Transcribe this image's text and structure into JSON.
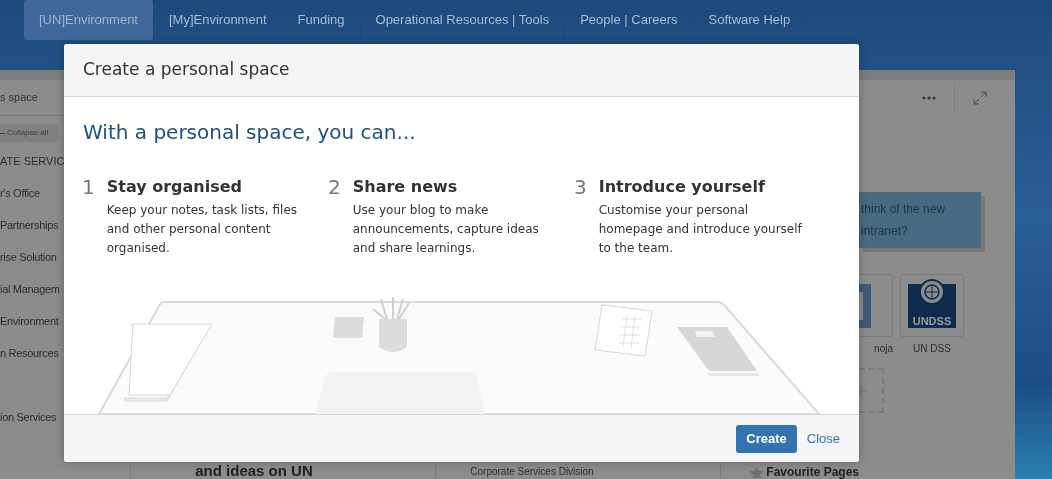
{
  "nav": {
    "tabs": [
      {
        "label": "[UN]Environment",
        "selected": true
      },
      {
        "label": "[My]Environment",
        "selected": false
      },
      {
        "label": "Funding",
        "selected": false
      },
      {
        "label": "Operational Resources | Tools",
        "selected": false
      },
      {
        "label": "People | Careers",
        "selected": false
      },
      {
        "label": "Software Help",
        "selected": false
      }
    ]
  },
  "sidebar": {
    "search": {
      "value": "s space"
    },
    "collapse_button": "Collapse all",
    "heading": "ATE SERVIC",
    "items": [
      "r's Office",
      "Partnerships",
      "rise Solution",
      "ial Managem",
      "Environment",
      "n Resources",
      "ion Services"
    ]
  },
  "content": {
    "heading": "and ideas on UN",
    "division": "Corporate Services Division",
    "favourites_title": "Favourite Pages"
  },
  "feedback_banner": {
    "lines": [
      "think of the new",
      "intranet?"
    ]
  },
  "apps": [
    {
      "label": "noja",
      "kind": "bracket"
    },
    {
      "label": "UN DSS",
      "kind": "emblem",
      "logo_text": "UNDSS"
    }
  ],
  "dialog": {
    "title": "Create a personal space",
    "heading": "With a personal space, you can...",
    "features": [
      {
        "number": "1",
        "title": "Stay organised",
        "text": "Keep your notes, task lists, files and other personal content organised."
      },
      {
        "number": "2",
        "title": "Share news",
        "text": "Use your blog to make announcements, capture ideas and share learnings."
      },
      {
        "number": "3",
        "title": "Introduce yourself",
        "text": "Customise your personal homepage and introduce yourself to the team."
      }
    ],
    "primary_button": "Create",
    "close_link": "Close"
  }
}
